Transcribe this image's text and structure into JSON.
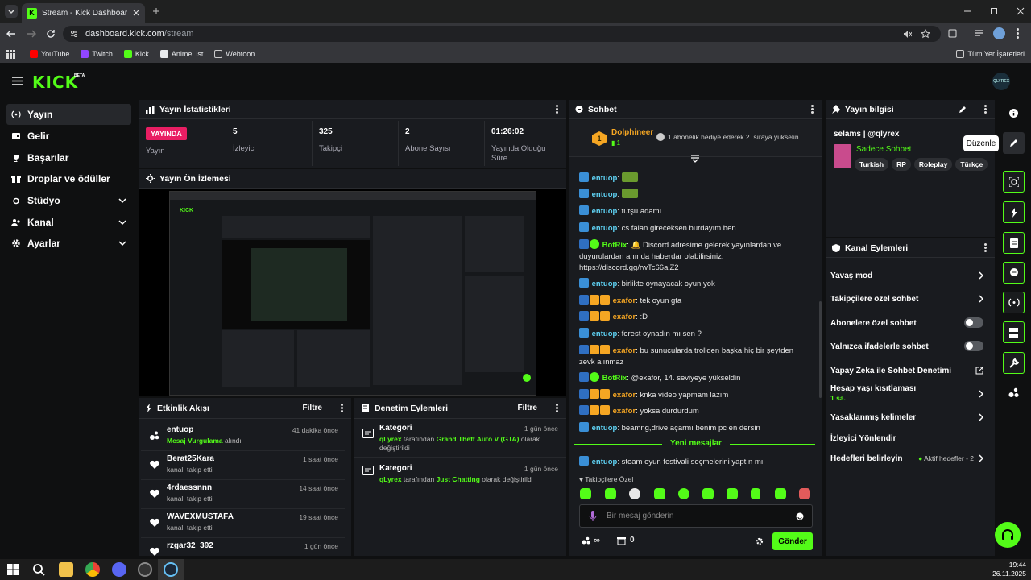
{
  "browser": {
    "tab_title": "Stream - Kick Dashboard",
    "url_host": "dashboard.kick.com",
    "url_path": "/stream",
    "bookmarks": [
      "YouTube",
      "Twitch",
      "Kick",
      "AnimeList",
      "Webtoon"
    ],
    "all_bookmarks": "Tüm Yer İşaretleri"
  },
  "brand": {
    "logo": "KICK",
    "beta": "BETA",
    "avatar": "QLYREX",
    "accent": "#53fc18"
  },
  "sidebar": {
    "items": [
      {
        "label": "Yayın",
        "icon": "broadcast-icon",
        "active": true
      },
      {
        "label": "Gelir",
        "icon": "wallet-icon"
      },
      {
        "label": "Başarılar",
        "icon": "trophy-icon"
      },
      {
        "label": "Droplar ve ödüller",
        "icon": "gift-icon"
      },
      {
        "label": "Stüdyo",
        "icon": "studio-icon",
        "expandable": true
      },
      {
        "label": "Kanal",
        "icon": "users-icon",
        "expandable": true
      },
      {
        "label": "Ayarlar",
        "icon": "gear-icon",
        "expandable": true
      }
    ]
  },
  "stats": {
    "title": "Yayın İstatistikleri",
    "live_badge": "YAYINDA",
    "live_label": "Yayın",
    "items": [
      {
        "value": "5",
        "label": "İzleyici"
      },
      {
        "value": "325",
        "label": "Takipçi"
      },
      {
        "value": "2",
        "label": "Abone Sayısı"
      },
      {
        "value": "01:26:02",
        "label": "Yayında Olduğu Süre"
      }
    ]
  },
  "preview": {
    "title": "Yayın Ön İzlemesi"
  },
  "activity": {
    "title": "Etkinlik Akışı",
    "filter": "Filtre",
    "events": [
      {
        "user": "entuop",
        "desc": "Mesaj Vurgulama alındı",
        "desc_link": "Mesaj Vurgulama",
        "desc_rest": " alındı",
        "time": "41 dakika önce",
        "icon": "highlight-icon"
      },
      {
        "user": "Berat25Kara",
        "desc": "kanalı takip etti",
        "time": "1 saat önce",
        "icon": "heart-icon"
      },
      {
        "user": "4rdaessnnn",
        "desc": "kanalı takip etti",
        "time": "14 saat önce",
        "icon": "heart-icon"
      },
      {
        "user": "WAVEXMUSTAFA",
        "desc": "kanalı takip etti",
        "time": "19 saat önce",
        "icon": "heart-icon"
      },
      {
        "user": "rzgar32_392",
        "desc": "",
        "time": "1 gün önce",
        "icon": "heart-icon"
      }
    ]
  },
  "moderation": {
    "title": "Denetim Eylemleri",
    "filter": "Filtre",
    "items": [
      {
        "title": "Kategori",
        "time": "1 gün önce",
        "by": "qLyrex",
        "mid": " tarafından ",
        "target": "Grand Theft Auto V (GTA)",
        "end": " olarak değiştirildi"
      },
      {
        "title": "Kategori",
        "time": "1 gün önce",
        "by": "qLyrex",
        "mid": " tarafından ",
        "target": "Just Chatting",
        "end": " olarak değiştirildi"
      }
    ]
  },
  "chat": {
    "title": "Sohbet",
    "pinned_user": "Dolphineer",
    "pinned_count": "1",
    "pinned_rank": "1",
    "pinned_text": "1 abonelik hediye ederek 2. sıraya yükselin",
    "messages": [
      {
        "user": "entuop",
        "text": ""
      },
      {
        "user": "entuop",
        "text": ""
      },
      {
        "user": "entuop",
        "text": "tutşu adamı"
      },
      {
        "user": "entuop",
        "text": "cs falan gireceksen burdayım ben"
      },
      {
        "user": "BotRix",
        "text": "🔔 Discord adresime gelerek yayınlardan ve duyurulardan anında haberdar olabilirsiniz. https://discord.gg/rwTc66ajZ2"
      },
      {
        "user": "entuop",
        "text": "birlikte oynayacak oyun yok"
      },
      {
        "user": "exafor",
        "text": "tek oyun gta"
      },
      {
        "user": "exafor",
        "text": ":D"
      },
      {
        "user": "entuop",
        "text": "forest oynadın mı sen ?"
      },
      {
        "user": "exafor",
        "text": "bu sunucularda trollden başka hiç bir şeytden zevk alınmaz"
      },
      {
        "user": "BotRix",
        "text": "@exafor, 14. seviyeye yükseldin"
      },
      {
        "user": "exafor",
        "text": "knka video yapmam lazım"
      },
      {
        "user": "exafor",
        "text": "yoksa durdurdum"
      },
      {
        "user": "entuop",
        "text": "beamng,drive açarmı benim pc en dersin"
      },
      {
        "user": "entuop",
        "text": "steam oyun festivali seçmelerini yaptın mı"
      }
    ],
    "new_messages": "Yeni mesajlar",
    "followers_only": "Takipçilere Özel",
    "input_placeholder": "Bir mesaj gönderin",
    "send": "Gönder",
    "points": "∞",
    "gifts": "0"
  },
  "stream_info": {
    "title": "Yayın bilgisi",
    "stream_title": "selams | @qlyrex",
    "category": "Sadece Sohbet",
    "tags": [
      "Turkish",
      "RP",
      "Roleplay",
      "Türkçe"
    ],
    "tooltip": "Düzenle"
  },
  "channel_actions": {
    "title": "Kanal Eylemleri",
    "items": [
      {
        "label": "Yavaş mod",
        "control": "chevron"
      },
      {
        "label": "Takipçilere özel sohbet",
        "control": "chevron"
      },
      {
        "label": "Abonelere özel sohbet",
        "control": "toggle",
        "on": false
      },
      {
        "label": "Yalnızca ifadelerle sohbet",
        "control": "toggle",
        "on": false
      },
      {
        "label": "Yapay Zeka ile Sohbet Denetimi",
        "control": "external"
      },
      {
        "label": "Hesap yaşı kısıtlaması",
        "sub": "1 sa.",
        "control": "chevron"
      },
      {
        "label": "Yasaklanmış kelimeler",
        "control": "chevron"
      },
      {
        "label": "İzleyici Yönlendir",
        "control": "none"
      },
      {
        "label": "Hedefleri belirleyin",
        "status": "Aktif hedefler - 2",
        "control": "chevron"
      }
    ]
  },
  "taskbar": {
    "time": "19:44",
    "date": "26.11.2025"
  }
}
